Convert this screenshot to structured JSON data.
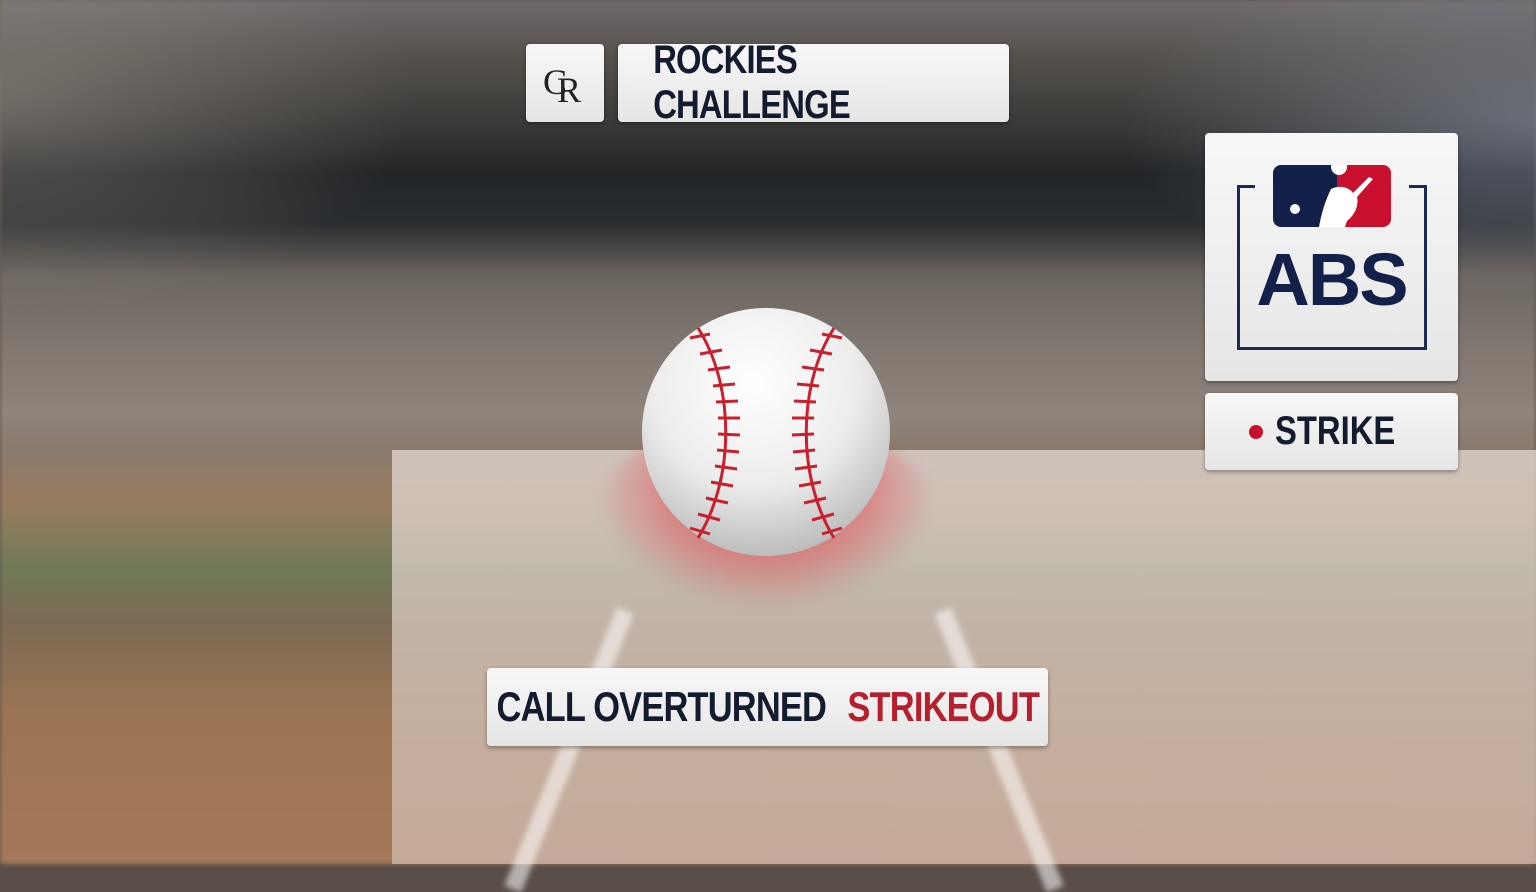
{
  "header": {
    "team_logo": "rockies-cr-logo",
    "team_logo_text": {
      "c": "C",
      "r": "R"
    },
    "challenge_label": "ROCKIES CHALLENGE"
  },
  "abs_panel": {
    "league_logo": "mlb-batter-logo",
    "abs_label": "ABS"
  },
  "call": {
    "result_label": "STRIKE",
    "result_color": "#c8102e"
  },
  "outcome": {
    "call_status": "CALL OVERTURNED",
    "play_result": "STRIKEOUT",
    "play_result_color": "#b51f2e"
  },
  "colors": {
    "navy": "#151b2e",
    "red": "#c8102e",
    "panel": "#f2f2f2"
  }
}
